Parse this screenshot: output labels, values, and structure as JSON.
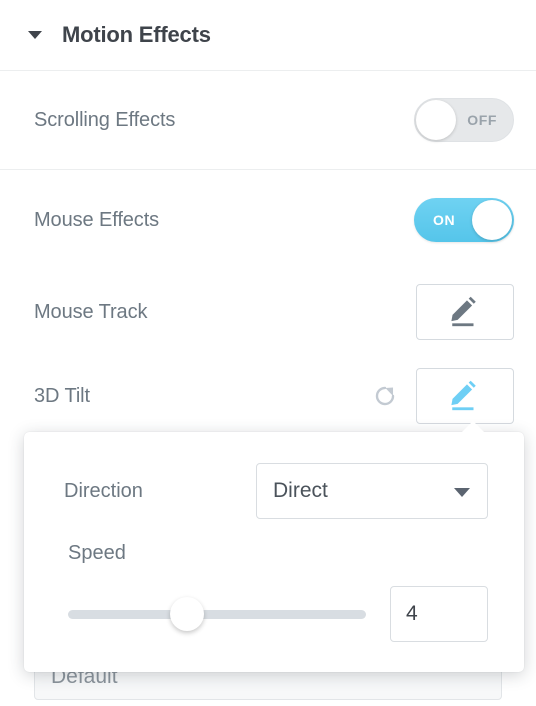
{
  "section": {
    "title": "Motion Effects",
    "collapse_icon": "chevron-down-icon"
  },
  "rows": {
    "scrolling_effects": {
      "label": "Scrolling Effects",
      "switch_state": "OFF"
    },
    "mouse_effects": {
      "label": "Mouse Effects",
      "switch_state": "ON"
    },
    "mouse_track": {
      "label": "Mouse Track",
      "edit_icon": "pencil-icon"
    },
    "tilt_3d": {
      "label": "3D Tilt",
      "reset_icon": "reset-icon",
      "edit_icon": "pencil-icon"
    }
  },
  "popover": {
    "direction": {
      "label": "Direction",
      "value": "Direct",
      "caret_icon": "chevron-down-icon"
    },
    "speed": {
      "label": "Speed",
      "value": "4",
      "slider_percent": 40
    }
  },
  "background": {
    "select_value": "Default"
  },
  "colors": {
    "accent": "#61cbef",
    "text": "#6d7882",
    "heading": "#3f444b",
    "border": "#eceeef"
  }
}
